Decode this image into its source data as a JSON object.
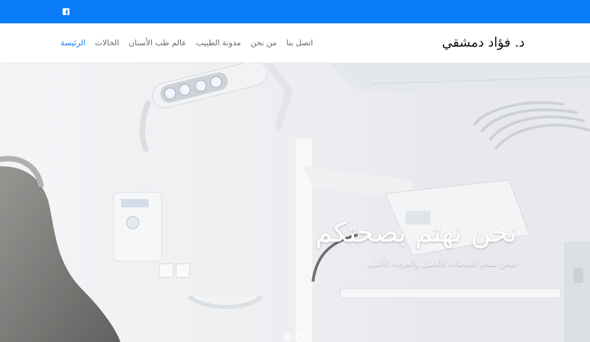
{
  "topbar": {
    "social_icon": "facebook-icon",
    "color": "#0a7cfa"
  },
  "brand": "د. فؤاد دمشقي",
  "nav": {
    "items": [
      {
        "label": "الرئيسة",
        "active": true
      },
      {
        "label": "الحالات"
      },
      {
        "label": "عالم طب الأسنان"
      },
      {
        "label": "مدونة الطبيب"
      },
      {
        "label": "من نحن"
      },
      {
        "label": "اتصل بنا"
      }
    ],
    "active_color": "#0a7cfa"
  },
  "hero": {
    "title": "نحن نهتم بصحتكم",
    "subtitle": "فنحن نقدم الخدمات الأفضل والجودة الأعلى.",
    "slides": 2,
    "active_slide": 1
  }
}
